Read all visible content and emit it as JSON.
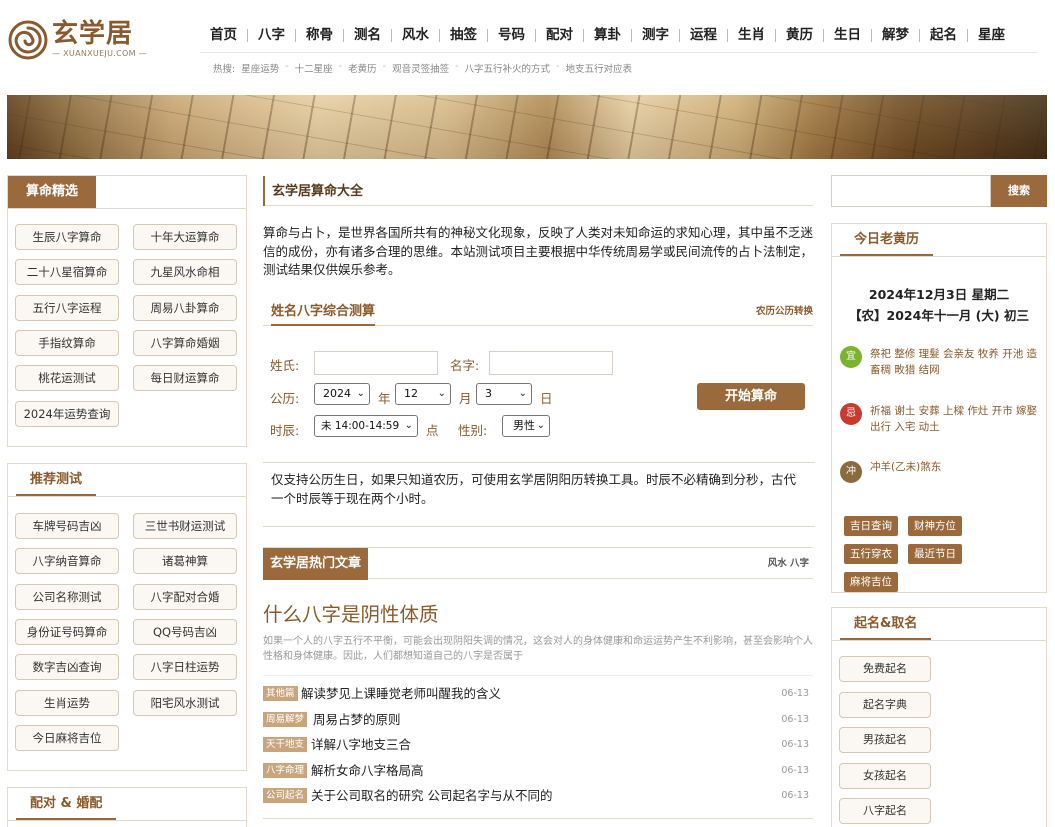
{
  "logo": {
    "text": "玄学居",
    "sub": "— XUANXUEJU.COM —"
  },
  "nav": [
    "首页",
    "八字",
    "称骨",
    "测名",
    "风水",
    "抽签",
    "号码",
    "配对",
    "算卦",
    "测字",
    "运程",
    "生肖",
    "黄历",
    "生日",
    "解梦",
    "起名",
    "星座"
  ],
  "hot": {
    "label": "热搜:",
    "items": [
      "星座运势",
      "十二星座",
      "老黄历",
      "观音灵签抽签",
      "八字五行补火的方式",
      "地支五行对应表"
    ]
  },
  "left": {
    "panel1": {
      "title": "算命精选",
      "buttons": [
        "生辰八字算命",
        "十年大运算命",
        "二十八星宿算命",
        "九星风水命相",
        "五行八字运程",
        "周易八卦算命",
        "手指纹算命",
        "八字算命婚姻",
        "桃花运测试",
        "每日财运算命",
        "2024年运势查询"
      ]
    },
    "panel2": {
      "title": "推荐测试",
      "buttons": [
        "车牌号码吉凶",
        "三世书财运测试",
        "八字纳音算命",
        "诸葛神算",
        "公司名称测试",
        "八字配对合婚",
        "身份证号码算命",
        "QQ号码吉凶",
        "数字吉凶查询",
        "八字日柱运势",
        "生肖运势",
        "阳宅风水测试",
        "今日麻将吉位"
      ]
    },
    "panel3": {
      "title": "配对 & 婚配"
    }
  },
  "center": {
    "title": "玄学居算命大全",
    "intro": "算命与占卜，是世界各国所共有的神秘文化现象，反映了人类对未知命运的求知心理，其中虽不乏迷信的成份，亦有诸多合理的思维。本站测试项目主要根据中华传统周易学或民间流传的占卜法制定，测试结果仅供娱乐参考。",
    "form": {
      "title": "姓名八字综合测算",
      "link": "农历公历转换",
      "surname_label": "姓氏:",
      "name_label": "名字:",
      "calendar_label": "公历:",
      "year": "2024",
      "year_unit": "年",
      "month": "12",
      "month_unit": "月",
      "day": "3",
      "day_unit": "日",
      "hour_label": "时辰:",
      "hour": "未 14:00-14:59",
      "hour_unit": "点",
      "gender_label": "性别:",
      "gender": "男性",
      "submit": "开始算命"
    },
    "note": "仅支持公历生日，如果只知道农历，可使用玄学居阴阳历转换工具。时辰不必精确到分秒，古代一个时辰等于现在两个小时。",
    "hot_articles": {
      "title": "玄学居热门文章",
      "links": "风水 八字",
      "feature_title": "什么八字是阴性体质",
      "feature_desc": "如果一个人的八字五行不平衡，可能会出现阴阳失调的情况，这会对人的身体健康和命运运势产生不利影响，甚至会影响个人性格和身体健康。因此，人们都想知道自己的八字是否属于",
      "list": [
        {
          "tag": "其他篇",
          "title": "解读梦见上课睡觉老师叫醒我的含义",
          "date": "06-13"
        },
        {
          "tag": "周易解梦",
          "title": "周易占梦的原则",
          "date": "06-13"
        },
        {
          "tag": "天干地支",
          "title": "详解八字地支三合",
          "date": "06-13"
        },
        {
          "tag": "八字命理",
          "title": "解析女命八字格局高",
          "date": "06-13"
        },
        {
          "tag": "公司起名",
          "title": "关于公司取名的研究 公司起名字与从不同的",
          "date": "06-13"
        }
      ]
    }
  },
  "right": {
    "search_button": "搜索",
    "almanac": {
      "title": "今日老黄历",
      "date": "2024年12月3日 星期二",
      "lunar": "【农】2024年十一月 (大) 初三",
      "yi_icon": "宜",
      "yi": "祭祀 整修 理髮 会亲友 牧养 开池 造畜稠 畋猎 结网",
      "ji_icon": "忌",
      "ji": "祈福 谢土 安葬 上樑 作灶 开市 嫁娶 出行 入宅 动土",
      "chong_icon": "冲",
      "chong": "冲羊(乙未)煞东",
      "tags": [
        "吉日查询",
        "财神方位",
        "五行穿衣",
        "最近节日",
        "麻将吉位"
      ]
    },
    "naming": {
      "title": "起名&取名",
      "buttons": [
        "免费起名",
        "起名字典",
        "男孩起名",
        "女孩起名",
        "八字起名"
      ]
    }
  },
  "colors": {
    "accent": "#9b6a3c",
    "border": "#e2d8cc",
    "yi": "#7bb32e",
    "ji": "#c63a2f",
    "chong": "#8b6a3d"
  }
}
